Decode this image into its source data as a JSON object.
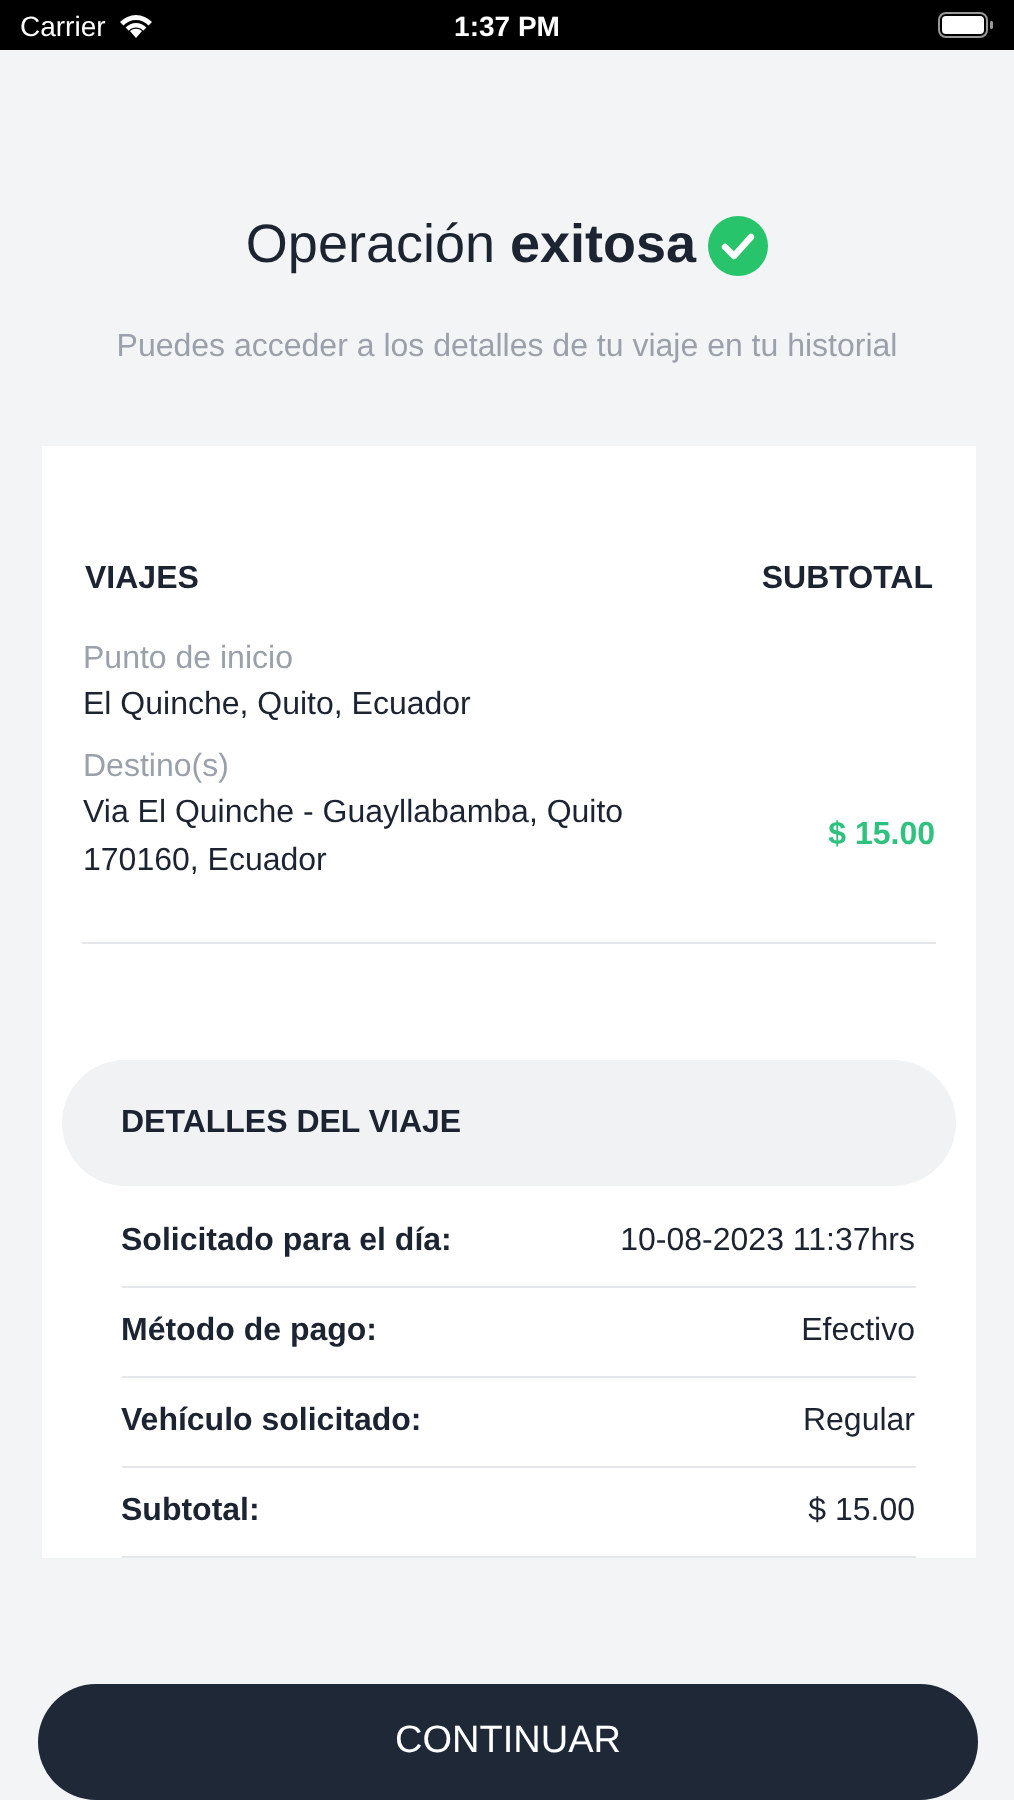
{
  "status_bar": {
    "carrier": "Carrier",
    "time": "1:37 PM"
  },
  "title": {
    "text": "Operación **exitosa**"
  },
  "subtitle": "Puedes acceder a los detalles de tu viaje en tu historial",
  "trips": {
    "header_left": "VIAJES",
    "header_right": "SUBTOTAL",
    "start_label": "Punto de inicio",
    "start_value": "El Quinche, Quito, Ecuador",
    "destination_label": "Destino(s)",
    "destination_value": "Via El Quinche - Guayllabamba, Quito 170160, Ecuador",
    "amount": "$ 15.00"
  },
  "details": {
    "title": "DETALLES DEL VIAJE",
    "rows": [
      {
        "label": "Solicitado para el día:",
        "value": "10-08-2023 11:37hrs"
      },
      {
        "label": "Método de pago:",
        "value": "Efectivo"
      },
      {
        "label": "Vehículo solicitado:",
        "value": "Regular"
      },
      {
        "label": "Subtotal:",
        "value": "$ 15.00"
      }
    ]
  },
  "button": "CONTINUAR"
}
